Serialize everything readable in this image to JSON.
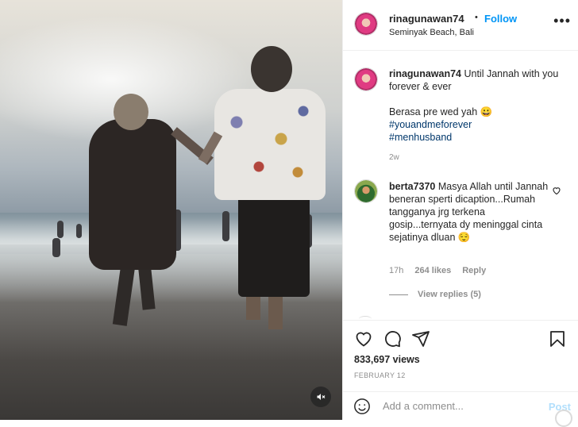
{
  "header": {
    "username": "rinagunawan74",
    "dot": "•",
    "follow_label": "Follow",
    "location": "Seminyak Beach, Bali",
    "more_icon": "more-horizontal-icon"
  },
  "caption": {
    "username": "rinagunawan74",
    "text_line1": "Until Jannah with you forever & ever",
    "text_line2": "Berasa pre wed yah 😀",
    "hashtags": [
      "#youandmeforever",
      "#menhusband"
    ],
    "time": "2w"
  },
  "comment": {
    "username": "berta7370",
    "text": "Masya Allah until Jannah beneran sperti dicaption...Rumah tangganya jrg terkena gosip...ternyata dy meninggal cinta sejatinya dluan 😌",
    "time": "17h",
    "likes": "264 likes",
    "reply_label": "Reply",
    "view_replies": "View replies (5)"
  },
  "actions": {
    "views": "833,697 views",
    "date": "FEBRUARY 12"
  },
  "comment_box": {
    "placeholder": "Add a comment...",
    "post_label": "Post"
  },
  "colors": {
    "accent": "#0095f6",
    "muted": "#8e8e8e",
    "hashtag": "#00376b"
  }
}
